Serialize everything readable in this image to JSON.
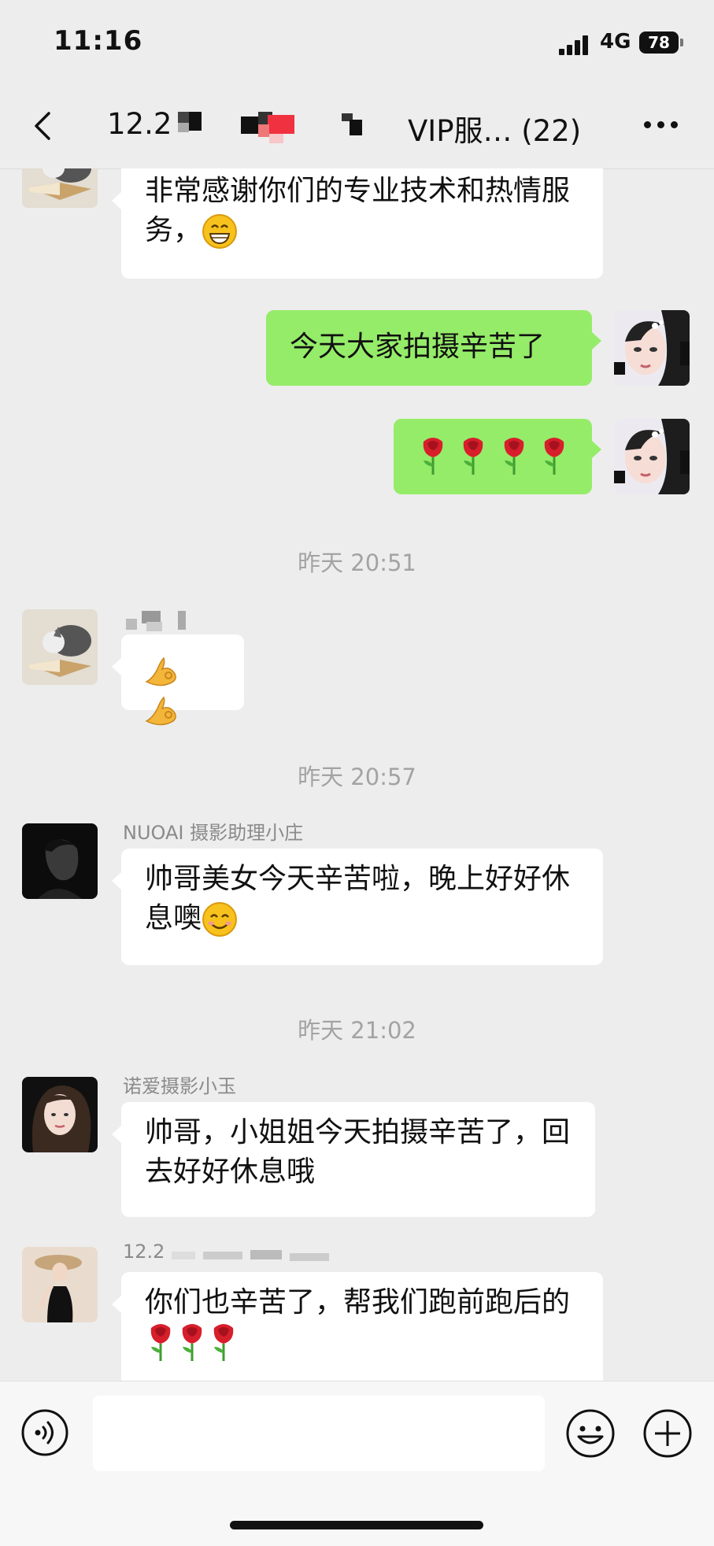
{
  "status_bar": {
    "time": "11:16",
    "network": "4G",
    "battery": "78"
  },
  "header": {
    "title_prefix": "12.2",
    "title_suffix": "VIP服… (22)"
  },
  "messages": {
    "m1": {
      "text": "非常感谢你们的专业技术和热情服务，"
    },
    "m2": {
      "text": "今天大家拍摄辛苦了"
    },
    "ts1": "昨天 20:51",
    "ts2": "昨天 20:57",
    "m5": {
      "sender": "NUOAI 摄影助理小庄",
      "text": "帅哥美女今天辛苦啦，晚上好好休息噢"
    },
    "ts3": "昨天 21:02",
    "m6": {
      "sender": "诺爱摄影小玉",
      "text": "帅哥，小姐姐今天拍摄辛苦了，回去好好休息哦"
    },
    "m7": {
      "sender": "12.2",
      "text": "你们也辛苦了，帮我们跑前跑后的"
    }
  },
  "colors": {
    "outgoing_bubble": "#95ec69",
    "background": "#ededed"
  },
  "icons": [
    "back-icon",
    "more-icon",
    "grin-emoji",
    "rose-emoji",
    "ok-hand-emoji",
    "smile-emoji",
    "voice-icon",
    "emoji-face-icon",
    "plus-icon"
  ]
}
